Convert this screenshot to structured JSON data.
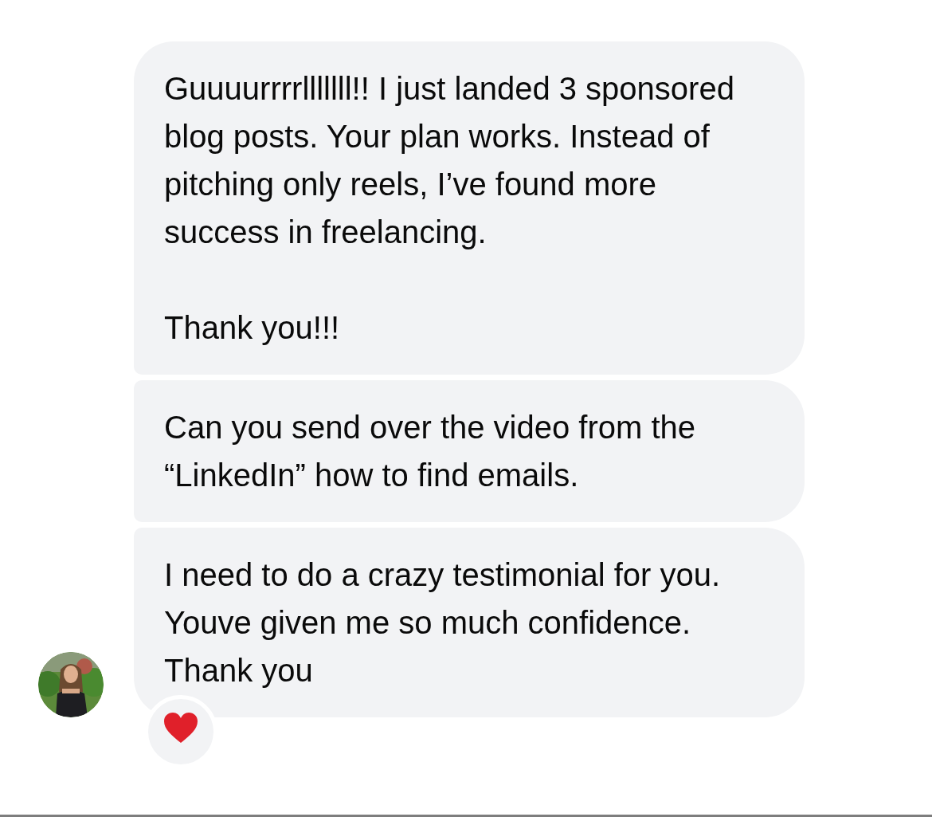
{
  "messages": [
    {
      "text": "Guuuurrrrlllllll!! I just landed 3 sponsored blog posts. Your plan works. Instead of pitching only reels, I’ve found more success in freelancing.\n\nThank you!!!"
    },
    {
      "text": "Can you send over the video from the “LinkedIn” how to find emails."
    },
    {
      "text": "I need to do a crazy testimonial for you. Youve given me so much confidence. Thank you"
    }
  ],
  "reactions": [
    {
      "kind": "heart"
    }
  ]
}
